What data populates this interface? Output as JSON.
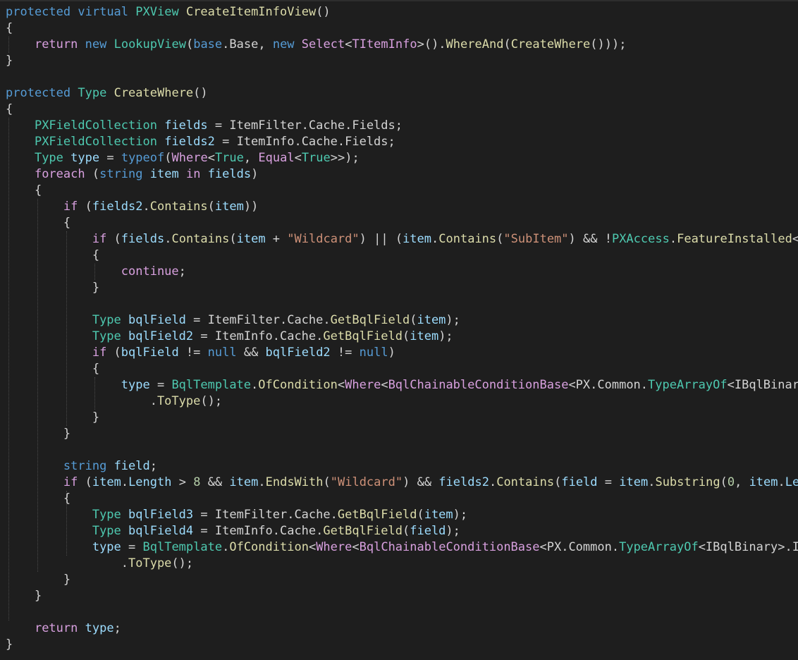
{
  "colors": {
    "background": "#1e1e1e",
    "keyword": "#569cd6",
    "control": "#d8a0df",
    "type": "#4ec9b0",
    "method": "#dcdcaa",
    "variable": "#9cdcfe",
    "string": "#ce9178",
    "number": "#b5cea8",
    "plain": "#d4d4d4",
    "guide": "#4a4a4a"
  },
  "editor": {
    "lines": [
      [
        [
          "keyword",
          "protected"
        ],
        [
          "plain",
          " "
        ],
        [
          "keyword",
          "virtual"
        ],
        [
          "plain",
          " "
        ],
        [
          "type",
          "PXView"
        ],
        [
          "plain",
          " "
        ],
        [
          "method",
          "CreateItemInfoView"
        ],
        [
          "plain",
          "()"
        ]
      ],
      [
        [
          "plain",
          "{"
        ]
      ],
      [
        [
          "plain",
          "    "
        ],
        [
          "control",
          "return"
        ],
        [
          "plain",
          " "
        ],
        [
          "keyword",
          "new"
        ],
        [
          "plain",
          " "
        ],
        [
          "type",
          "LookupView"
        ],
        [
          "plain",
          "("
        ],
        [
          "keyword",
          "base"
        ],
        [
          "plain",
          "."
        ],
        [
          "plain",
          "Base, "
        ],
        [
          "keyword",
          "new"
        ],
        [
          "plain",
          " "
        ],
        [
          "control",
          "Select"
        ],
        [
          "plain",
          "<"
        ],
        [
          "control",
          "TItemInfo"
        ],
        [
          "plain",
          ">()."
        ],
        [
          "method",
          "WhereAnd"
        ],
        [
          "plain",
          "("
        ],
        [
          "method",
          "CreateWhere"
        ],
        [
          "plain",
          "()));"
        ]
      ],
      [
        [
          "plain",
          "}"
        ]
      ],
      [],
      [
        [
          "keyword",
          "protected"
        ],
        [
          "plain",
          " "
        ],
        [
          "type",
          "Type"
        ],
        [
          "plain",
          " "
        ],
        [
          "method",
          "CreateWhere"
        ],
        [
          "plain",
          "()"
        ]
      ],
      [
        [
          "plain",
          "{"
        ]
      ],
      [
        [
          "plain",
          "    "
        ],
        [
          "type",
          "PXFieldCollection"
        ],
        [
          "plain",
          " "
        ],
        [
          "variable",
          "fields"
        ],
        [
          "plain",
          " = ItemFilter."
        ],
        [
          "plain",
          "Cache."
        ],
        [
          "plain",
          "Fields;"
        ]
      ],
      [
        [
          "plain",
          "    "
        ],
        [
          "type",
          "PXFieldCollection"
        ],
        [
          "plain",
          " "
        ],
        [
          "variable",
          "fields2"
        ],
        [
          "plain",
          " = ItemInfo."
        ],
        [
          "plain",
          "Cache."
        ],
        [
          "plain",
          "Fields;"
        ]
      ],
      [
        [
          "plain",
          "    "
        ],
        [
          "type",
          "Type"
        ],
        [
          "plain",
          " "
        ],
        [
          "variable",
          "type"
        ],
        [
          "plain",
          " = "
        ],
        [
          "keyword",
          "typeof"
        ],
        [
          "plain",
          "("
        ],
        [
          "control",
          "Where"
        ],
        [
          "plain",
          "<"
        ],
        [
          "type",
          "True"
        ],
        [
          "plain",
          ", "
        ],
        [
          "control",
          "Equal"
        ],
        [
          "plain",
          "<"
        ],
        [
          "type",
          "True"
        ],
        [
          "plain",
          ">>);"
        ]
      ],
      [
        [
          "plain",
          "    "
        ],
        [
          "control",
          "foreach"
        ],
        [
          "plain",
          " ("
        ],
        [
          "keyword",
          "string"
        ],
        [
          "plain",
          " "
        ],
        [
          "variable",
          "item"
        ],
        [
          "plain",
          " "
        ],
        [
          "control",
          "in"
        ],
        [
          "plain",
          " "
        ],
        [
          "variable",
          "fields"
        ],
        [
          "plain",
          ")"
        ]
      ],
      [
        [
          "plain",
          "    {"
        ]
      ],
      [
        [
          "plain",
          "        "
        ],
        [
          "control",
          "if"
        ],
        [
          "plain",
          " ("
        ],
        [
          "variable",
          "fields2"
        ],
        [
          "plain",
          "."
        ],
        [
          "method",
          "Contains"
        ],
        [
          "plain",
          "("
        ],
        [
          "variable",
          "item"
        ],
        [
          "plain",
          "))"
        ]
      ],
      [
        [
          "plain",
          "        {"
        ]
      ],
      [
        [
          "plain",
          "            "
        ],
        [
          "control",
          "if"
        ],
        [
          "plain",
          " ("
        ],
        [
          "variable",
          "fields"
        ],
        [
          "plain",
          "."
        ],
        [
          "method",
          "Contains"
        ],
        [
          "plain",
          "("
        ],
        [
          "variable",
          "item"
        ],
        [
          "plain",
          " + "
        ],
        [
          "string",
          "\"Wildcard\""
        ],
        [
          "plain",
          ") || ("
        ],
        [
          "variable",
          "item"
        ],
        [
          "plain",
          "."
        ],
        [
          "method",
          "Contains"
        ],
        [
          "plain",
          "("
        ],
        [
          "string",
          "\"SubItem\""
        ],
        [
          "plain",
          ") && !"
        ],
        [
          "type",
          "PXAccess"
        ],
        [
          "plain",
          "."
        ],
        [
          "method",
          "FeatureInstalled"
        ],
        [
          "plain",
          "<"
        ]
      ],
      [
        [
          "plain",
          "            {"
        ]
      ],
      [
        [
          "plain",
          "                "
        ],
        [
          "control",
          "continue"
        ],
        [
          "plain",
          ";"
        ]
      ],
      [
        [
          "plain",
          "            }"
        ]
      ],
      [],
      [
        [
          "plain",
          "            "
        ],
        [
          "type",
          "Type"
        ],
        [
          "plain",
          " "
        ],
        [
          "variable",
          "bqlField"
        ],
        [
          "plain",
          " = ItemFilter.Cache."
        ],
        [
          "method",
          "GetBqlField"
        ],
        [
          "plain",
          "("
        ],
        [
          "variable",
          "item"
        ],
        [
          "plain",
          ");"
        ]
      ],
      [
        [
          "plain",
          "            "
        ],
        [
          "type",
          "Type"
        ],
        [
          "plain",
          " "
        ],
        [
          "variable",
          "bqlField2"
        ],
        [
          "plain",
          " = ItemInfo.Cache."
        ],
        [
          "method",
          "GetBqlField"
        ],
        [
          "plain",
          "("
        ],
        [
          "variable",
          "item"
        ],
        [
          "plain",
          ");"
        ]
      ],
      [
        [
          "plain",
          "            "
        ],
        [
          "control",
          "if"
        ],
        [
          "plain",
          " ("
        ],
        [
          "variable",
          "bqlField"
        ],
        [
          "plain",
          " != "
        ],
        [
          "keyword",
          "null"
        ],
        [
          "plain",
          " && "
        ],
        [
          "variable",
          "bqlField2"
        ],
        [
          "plain",
          " != "
        ],
        [
          "keyword",
          "null"
        ],
        [
          "plain",
          ")"
        ]
      ],
      [
        [
          "plain",
          "            {"
        ]
      ],
      [
        [
          "plain",
          "                "
        ],
        [
          "variable",
          "type"
        ],
        [
          "plain",
          " = "
        ],
        [
          "type",
          "BqlTemplate"
        ],
        [
          "plain",
          "."
        ],
        [
          "method",
          "OfCondition"
        ],
        [
          "plain",
          "<"
        ],
        [
          "control",
          "Where"
        ],
        [
          "plain",
          "<"
        ],
        [
          "control",
          "BqlChainableConditionBase"
        ],
        [
          "plain",
          "<PX.Common."
        ],
        [
          "type",
          "TypeArrayOf"
        ],
        [
          "plain",
          "<IBqlBinar"
        ]
      ],
      [
        [
          "plain",
          "                    ."
        ],
        [
          "method",
          "ToType"
        ],
        [
          "plain",
          "();"
        ]
      ],
      [
        [
          "plain",
          "            }"
        ]
      ],
      [
        [
          "plain",
          "        }"
        ]
      ],
      [],
      [
        [
          "plain",
          "        "
        ],
        [
          "keyword",
          "string"
        ],
        [
          "plain",
          " "
        ],
        [
          "variable",
          "field"
        ],
        [
          "plain",
          ";"
        ]
      ],
      [
        [
          "plain",
          "        "
        ],
        [
          "control",
          "if"
        ],
        [
          "plain",
          " ("
        ],
        [
          "variable",
          "item"
        ],
        [
          "plain",
          "."
        ],
        [
          "variable",
          "Length"
        ],
        [
          "plain",
          " > "
        ],
        [
          "number",
          "8"
        ],
        [
          "plain",
          " && "
        ],
        [
          "variable",
          "item"
        ],
        [
          "plain",
          "."
        ],
        [
          "method",
          "EndsWith"
        ],
        [
          "plain",
          "("
        ],
        [
          "string",
          "\"Wildcard\""
        ],
        [
          "plain",
          ") && "
        ],
        [
          "variable",
          "fields2"
        ],
        [
          "plain",
          "."
        ],
        [
          "method",
          "Contains"
        ],
        [
          "plain",
          "("
        ],
        [
          "variable",
          "field"
        ],
        [
          "plain",
          " = "
        ],
        [
          "variable",
          "item"
        ],
        [
          "plain",
          "."
        ],
        [
          "method",
          "Substring"
        ],
        [
          "plain",
          "("
        ],
        [
          "number",
          "0"
        ],
        [
          "plain",
          ", "
        ],
        [
          "variable",
          "item"
        ],
        [
          "plain",
          "."
        ],
        [
          "variable",
          "Le"
        ]
      ],
      [
        [
          "plain",
          "        {"
        ]
      ],
      [
        [
          "plain",
          "            "
        ],
        [
          "type",
          "Type"
        ],
        [
          "plain",
          " "
        ],
        [
          "variable",
          "bqlField3"
        ],
        [
          "plain",
          " = ItemFilter.Cache."
        ],
        [
          "method",
          "GetBqlField"
        ],
        [
          "plain",
          "("
        ],
        [
          "variable",
          "item"
        ],
        [
          "plain",
          ");"
        ]
      ],
      [
        [
          "plain",
          "            "
        ],
        [
          "type",
          "Type"
        ],
        [
          "plain",
          " "
        ],
        [
          "variable",
          "bqlField4"
        ],
        [
          "plain",
          " = ItemInfo.Cache."
        ],
        [
          "method",
          "GetBqlField"
        ],
        [
          "plain",
          "("
        ],
        [
          "variable",
          "field"
        ],
        [
          "plain",
          ");"
        ]
      ],
      [
        [
          "plain",
          "            "
        ],
        [
          "variable",
          "type"
        ],
        [
          "plain",
          " = "
        ],
        [
          "type",
          "BqlTemplate"
        ],
        [
          "plain",
          "."
        ],
        [
          "method",
          "OfCondition"
        ],
        [
          "plain",
          "<"
        ],
        [
          "control",
          "Where"
        ],
        [
          "plain",
          "<"
        ],
        [
          "control",
          "BqlChainableConditionBase"
        ],
        [
          "plain",
          "<PX.Common."
        ],
        [
          "type",
          "TypeArrayOf"
        ],
        [
          "plain",
          "<IBqlBinary>.I"
        ]
      ],
      [
        [
          "plain",
          "                ."
        ],
        [
          "method",
          "ToType"
        ],
        [
          "plain",
          "();"
        ]
      ],
      [
        [
          "plain",
          "        }"
        ]
      ],
      [
        [
          "plain",
          "    }"
        ]
      ],
      [],
      [
        [
          "plain",
          "    "
        ],
        [
          "control",
          "return"
        ],
        [
          "plain",
          " "
        ],
        [
          "variable",
          "type"
        ],
        [
          "plain",
          ";"
        ]
      ],
      [
        [
          "plain",
          "}"
        ]
      ]
    ]
  }
}
